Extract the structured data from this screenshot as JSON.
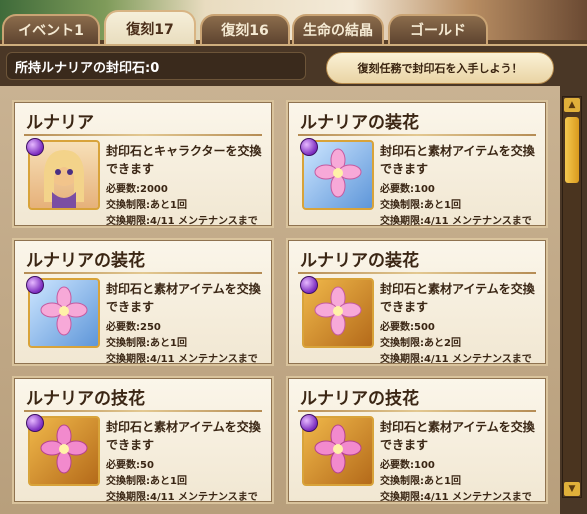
{
  "tabs": [
    {
      "label": "イベント1"
    },
    {
      "label": "復刻17"
    },
    {
      "label": "復刻16"
    },
    {
      "label": "生命の結晶"
    },
    {
      "label": "ゴールド"
    }
  ],
  "owned_label": "所持ルナリアの封印石:0",
  "hint_label": "復刻任務で封印石を入手しよう！",
  "cards": [
    {
      "title": "ルナリア",
      "desc": "封印石とキャラクターを交換できます",
      "required": "必要数:2000",
      "limit": "交換制限:あと1回",
      "period": "交換期限:4/11 メンテナンスまで",
      "icon": "portrait-icon"
    },
    {
      "title": "ルナリアの装花",
      "desc": "封印石と素材アイテムを交換できます",
      "required": "必要数:100",
      "limit": "交換制限:あと1回",
      "period": "交換期限:4/11 メンテナンスまで",
      "icon": "flower-icon"
    },
    {
      "title": "ルナリアの装花",
      "desc": "封印石と素材アイテムを交換できます",
      "required": "必要数:250",
      "limit": "交換制限:あと1回",
      "period": "交換期限:4/11 メンテナンスまで",
      "icon": "flower-icon"
    },
    {
      "title": "ルナリアの装花",
      "desc": "封印石と素材アイテムを交換できます",
      "required": "必要数:500",
      "limit": "交換制限:あと2回",
      "period": "交換期限:4/11 メンテナンスまで",
      "icon": "flower-icon"
    },
    {
      "title": "ルナリアの技花",
      "desc": "封印石と素材アイテムを交換できます",
      "required": "必要数:50",
      "limit": "交換制限:あと1回",
      "period": "交換期限:4/11 メンテナンスまで",
      "icon": "flower-icon"
    },
    {
      "title": "ルナリアの技花",
      "desc": "封印石と素材アイテムを交換できます",
      "required": "必要数:100",
      "limit": "交換制限:あと1回",
      "period": "交換期限:4/11 メンテナンスまで",
      "icon": "flower-icon"
    }
  ]
}
